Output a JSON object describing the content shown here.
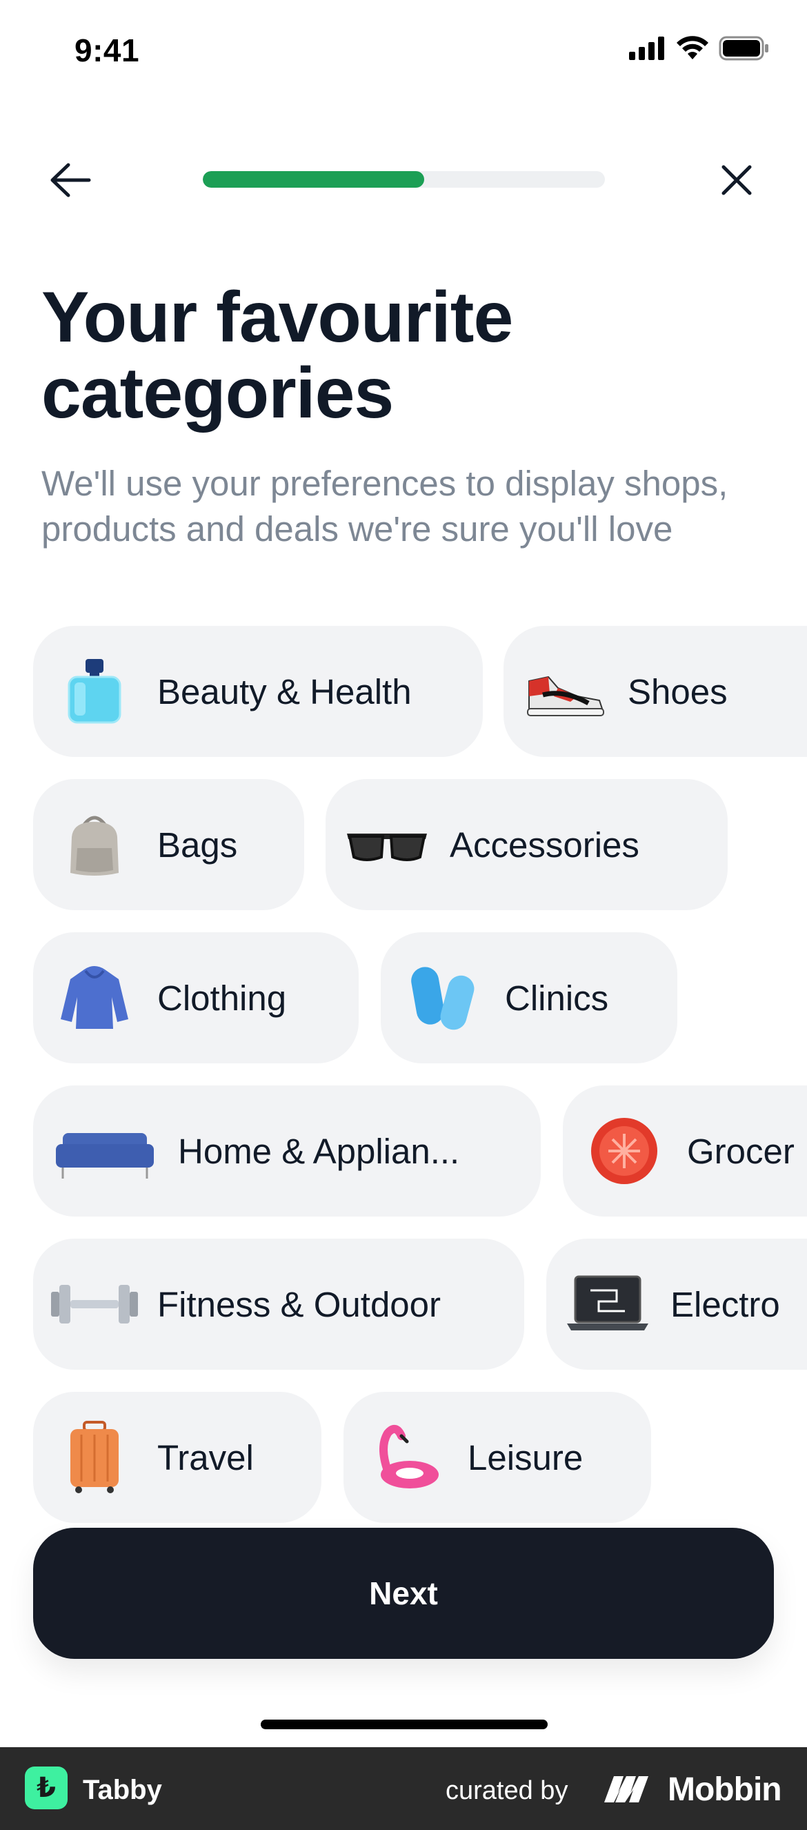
{
  "status_bar": {
    "time": "9:41"
  },
  "nav": {
    "back_icon": "arrow-left-icon",
    "close_icon": "close-icon",
    "progress": 0.55
  },
  "header": {
    "title_line1": "Your favourite",
    "title_line2": "categories",
    "subtitle_line1": "We'll use your preferences to display shops,",
    "subtitle_line2": "products and deals we're sure you'll love"
  },
  "categories": [
    {
      "label": "Beauty & Health",
      "icon": "perfume-icon"
    },
    {
      "label": "Shoes",
      "icon": "sneaker-icon"
    },
    {
      "label": "Bags",
      "icon": "backpack-icon"
    },
    {
      "label": "Accessories",
      "icon": "sunglasses-icon"
    },
    {
      "label": "Clothing",
      "icon": "hoodie-icon"
    },
    {
      "label": "Clinics",
      "icon": "pills-icon"
    },
    {
      "label": "Home & Applian...",
      "icon": "sofa-icon"
    },
    {
      "label": "Grocer",
      "icon": "tomato-icon"
    },
    {
      "label": "Fitness & Outdoor",
      "icon": "dumbbell-icon"
    },
    {
      "label": "Electro",
      "icon": "laptop-icon"
    },
    {
      "label": "Travel",
      "icon": "suitcase-icon"
    },
    {
      "label": "Leisure",
      "icon": "flamingo-float-icon"
    }
  ],
  "actions": {
    "next_label": "Next"
  },
  "footer": {
    "app_name": "Tabby",
    "curated_by": "curated by",
    "brand": "Mobbin"
  },
  "colors": {
    "accent": "#1c9f55",
    "button_bg": "#161b26",
    "chip_bg": "#f2f3f5",
    "subtitle": "#7d8794"
  }
}
